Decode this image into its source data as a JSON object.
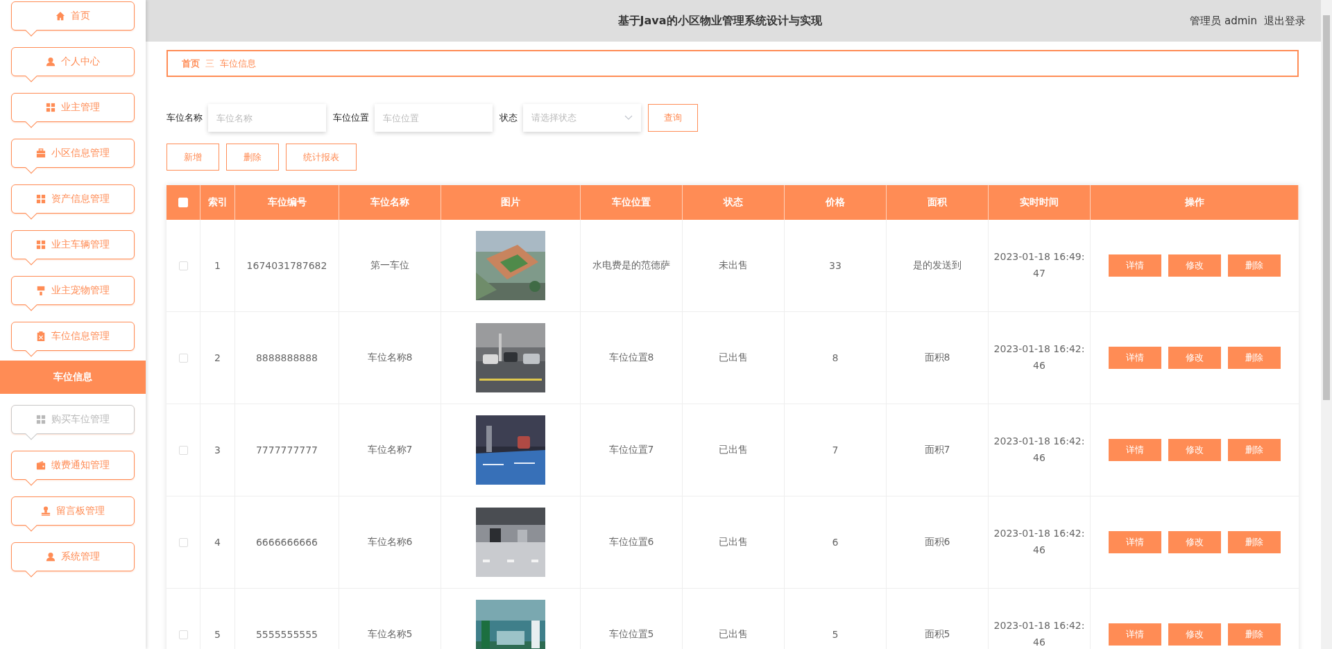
{
  "sidebar": {
    "items": [
      {
        "label": "首页",
        "hovered": false
      },
      {
        "label": "个人中心",
        "hovered": false
      },
      {
        "label": "业主管理",
        "hovered": false
      },
      {
        "label": "小区信息管理",
        "hovered": false
      },
      {
        "label": "资产信息管理",
        "hovered": false
      },
      {
        "label": "业主车辆管理",
        "hovered": false
      },
      {
        "label": "业主宠物管理",
        "hovered": false
      },
      {
        "label": "车位信息管理",
        "hovered": false,
        "children": [
          {
            "label": "车位信息",
            "selected": true
          }
        ]
      },
      {
        "label": "购买车位管理",
        "hovered": true
      },
      {
        "label": "缴费通知管理",
        "hovered": false
      },
      {
        "label": "留言板管理",
        "hovered": false
      },
      {
        "label": "系统管理",
        "hovered": false
      }
    ]
  },
  "header": {
    "title": "基于Java的小区物业管理系统设计与实现",
    "user": "管理员 admin",
    "logout": "退出登录"
  },
  "breadcrumb": {
    "items": [
      "首页",
      "车位信息"
    ],
    "separator": "三"
  },
  "search": {
    "fields": [
      {
        "kind": "input",
        "label": "车位名称",
        "placeholder": "车位名称"
      },
      {
        "kind": "input",
        "label": "车位位置",
        "placeholder": "车位位置"
      },
      {
        "kind": "select",
        "label": "状态",
        "placeholder": "请选择状态"
      }
    ],
    "button": "查询"
  },
  "actions": [
    "新增",
    "删除",
    "统计报表"
  ],
  "table": {
    "columns": [
      "索引",
      "车位编号",
      "车位名称",
      "图片",
      "车位位置",
      "状态",
      "价格",
      "面积",
      "实时时间",
      "操作"
    ],
    "header_checked": false,
    "rows": [
      {
        "checked": false,
        "cells": [
          "1",
          "1674031787682",
          "第一车位",
          {
            "kind": "picture"
          },
          "水电费是的范德萨",
          "未出售",
          "33",
          "是的发送到",
          "2023-01-18 16:49:47"
        ],
        "buttons": [
          "详情",
          "修改",
          "删除"
        ]
      },
      {
        "checked": false,
        "cells": [
          "2",
          "8888888888",
          "车位名称8",
          {
            "kind": "picture"
          },
          "车位位置8",
          "已出售",
          "8",
          "面积8",
          "2023-01-18 16:42:46"
        ],
        "buttons": [
          "详情",
          "修改",
          "删除"
        ]
      },
      {
        "checked": false,
        "cells": [
          "3",
          "7777777777",
          "车位名称7",
          {
            "kind": "picture"
          },
          "车位位置7",
          "已出售",
          "7",
          "面积7",
          "2023-01-18 16:42:46"
        ],
        "buttons": [
          "详情",
          "修改",
          "删除"
        ]
      },
      {
        "checked": false,
        "cells": [
          "4",
          "6666666666",
          "车位名称6",
          {
            "kind": "picture"
          },
          "车位位置6",
          "已出售",
          "6",
          "面积6",
          "2023-01-18 16:42:46"
        ],
        "buttons": [
          "详情",
          "修改",
          "删除"
        ]
      },
      {
        "checked": false,
        "cells": [
          "5",
          "5555555555",
          "车位名称5",
          {
            "kind": "picture"
          },
          "车位位置5",
          "已出售",
          "5",
          "面积5",
          "2023-01-18 16:42:46"
        ],
        "buttons": [
          "详情",
          "修改",
          "删除"
        ]
      }
    ]
  }
}
